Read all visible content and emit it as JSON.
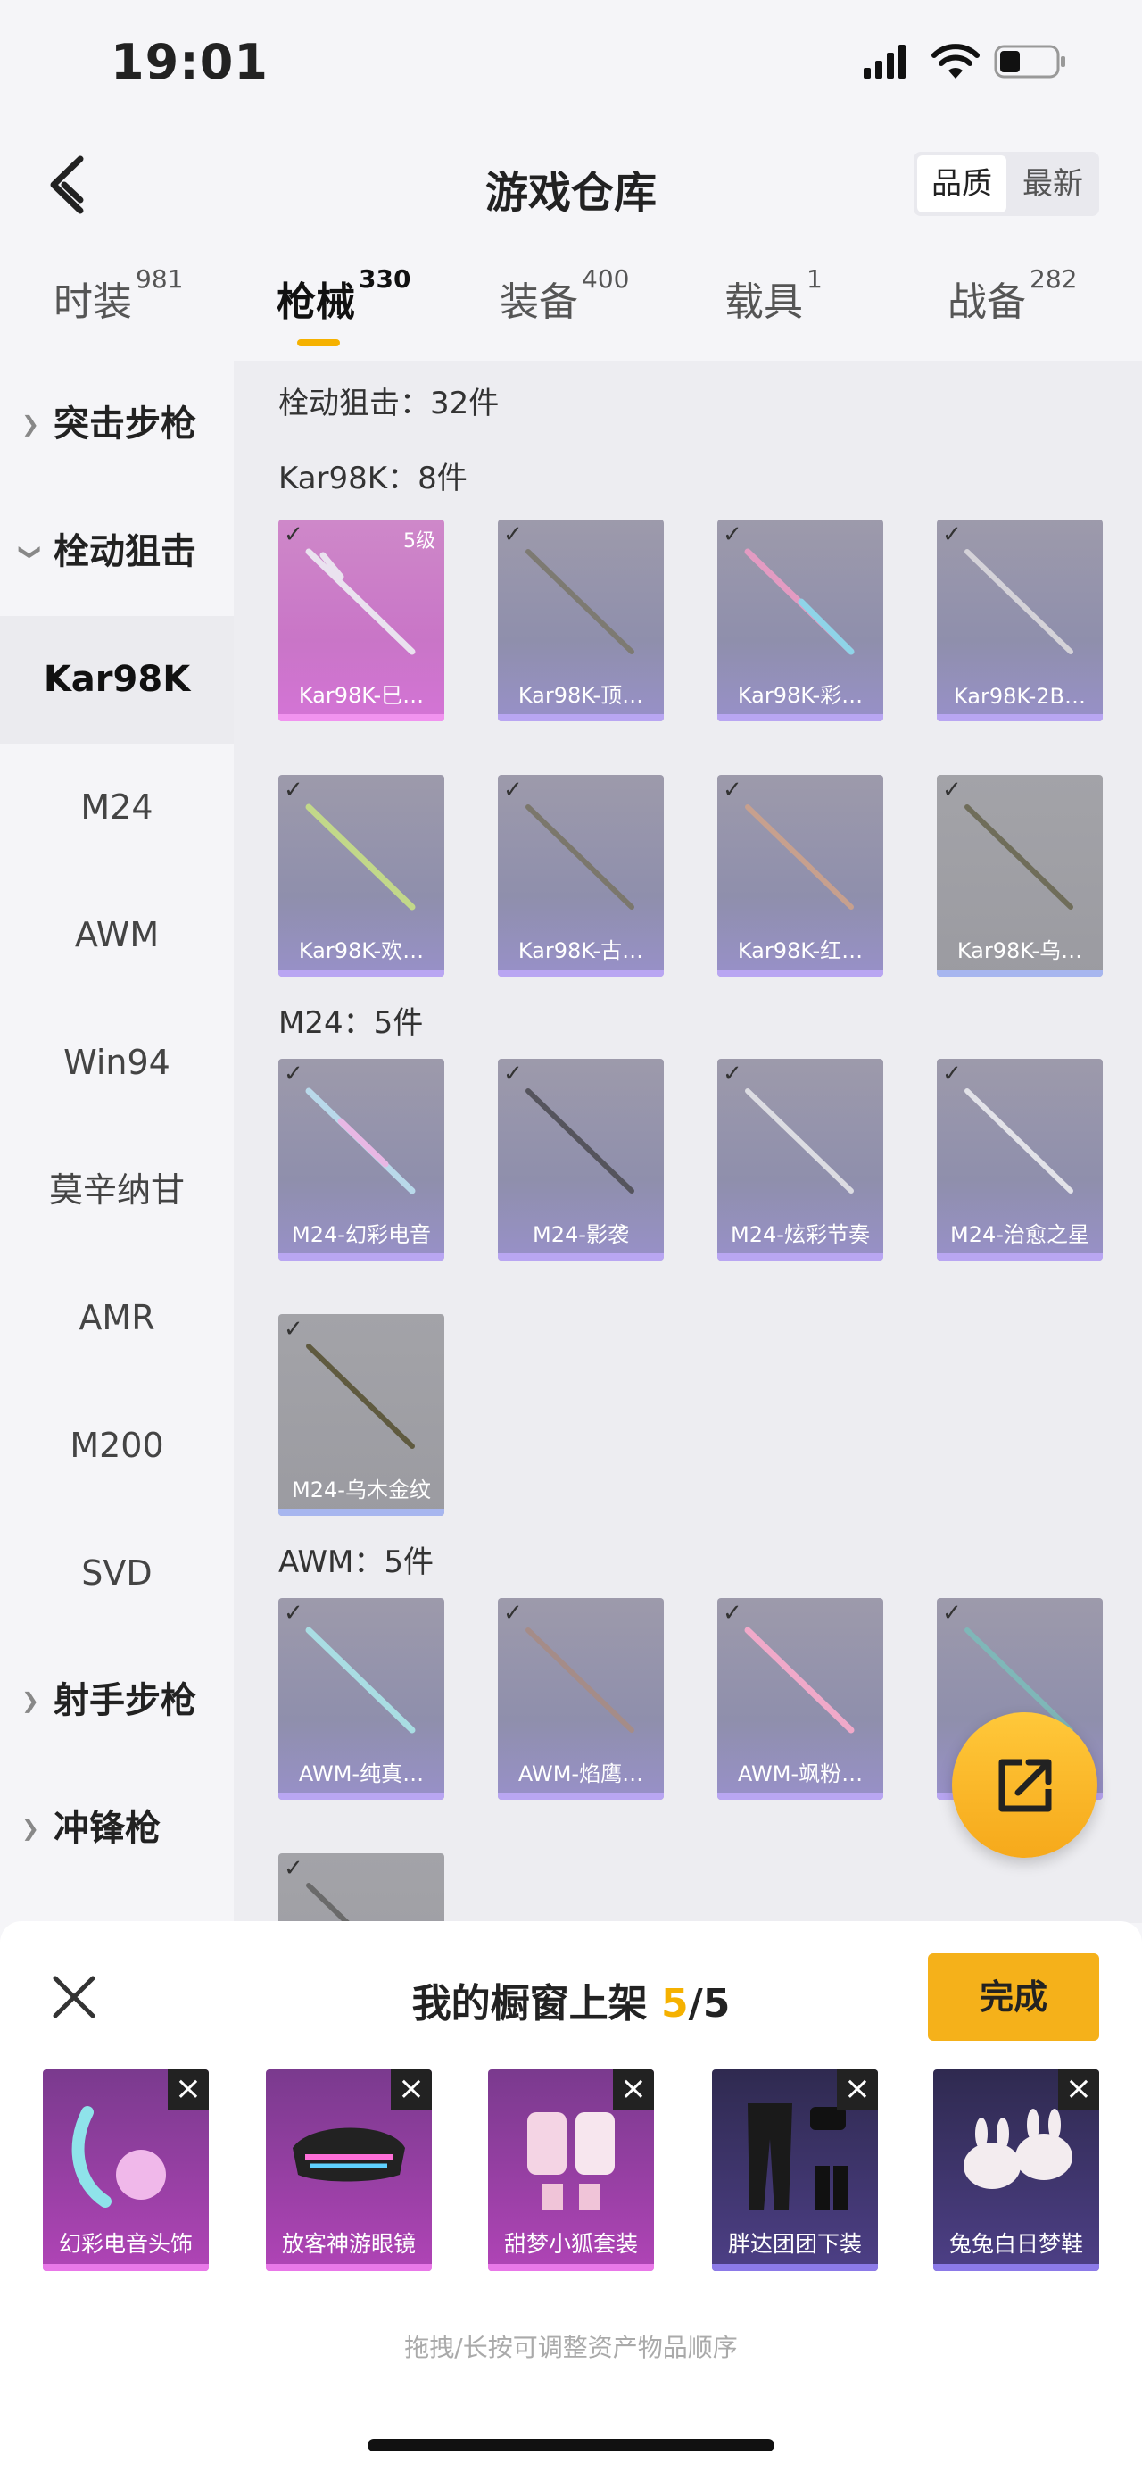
{
  "status": {
    "time": "19:01"
  },
  "header": {
    "title": "游戏仓库",
    "sort_options": [
      "品质",
      "最新"
    ]
  },
  "tabs": [
    {
      "label": "时装",
      "count": "981"
    },
    {
      "label": "枪械",
      "count": "330"
    },
    {
      "label": "装备",
      "count": "400"
    },
    {
      "label": "载具",
      "count": "1"
    },
    {
      "label": "战备",
      "count": "282"
    }
  ],
  "sidebar": [
    "突击步枪",
    "栓动狙击",
    "Kar98K",
    "M24",
    "AWM",
    "Win94",
    "莫辛纳甘",
    "AMR",
    "M200",
    "SVD",
    "射手步枪",
    "冲锋枪"
  ],
  "content": {
    "section_total": "栓动狙击：32件",
    "groups": [
      {
        "title": "Kar98K：8件",
        "level_badge": "5级",
        "items": [
          "Kar98K-巳…",
          "Kar98K-顶…",
          "Kar98K-彩…",
          "Kar98K-2B…",
          "Kar98K-欢…",
          "Kar98K-古…",
          "Kar98K-红…",
          "Kar98K-乌…"
        ]
      },
      {
        "title": "M24：5件",
        "items": [
          "M24-幻彩电音",
          "M24-影袭",
          "M24-炫彩节奏",
          "M24-治愈之星",
          "M24-乌木金纹"
        ]
      },
      {
        "title": "AWM：5件",
        "items": [
          "AWM-纯真…",
          "AWM-焰鹰…",
          "AWM-飒粉…",
          ""
        ]
      }
    ]
  },
  "showcase": {
    "title_prefix": "我的橱窗上架 ",
    "current": "5",
    "total": "/5",
    "done_label": "完成",
    "items": [
      "幻彩电音头饰",
      "放客神游眼镜",
      "甜梦小狐套装",
      "胖达团团下装",
      "兔兔白日梦鞋"
    ],
    "hint": "拖拽/长按可调整资产物品顺序"
  }
}
